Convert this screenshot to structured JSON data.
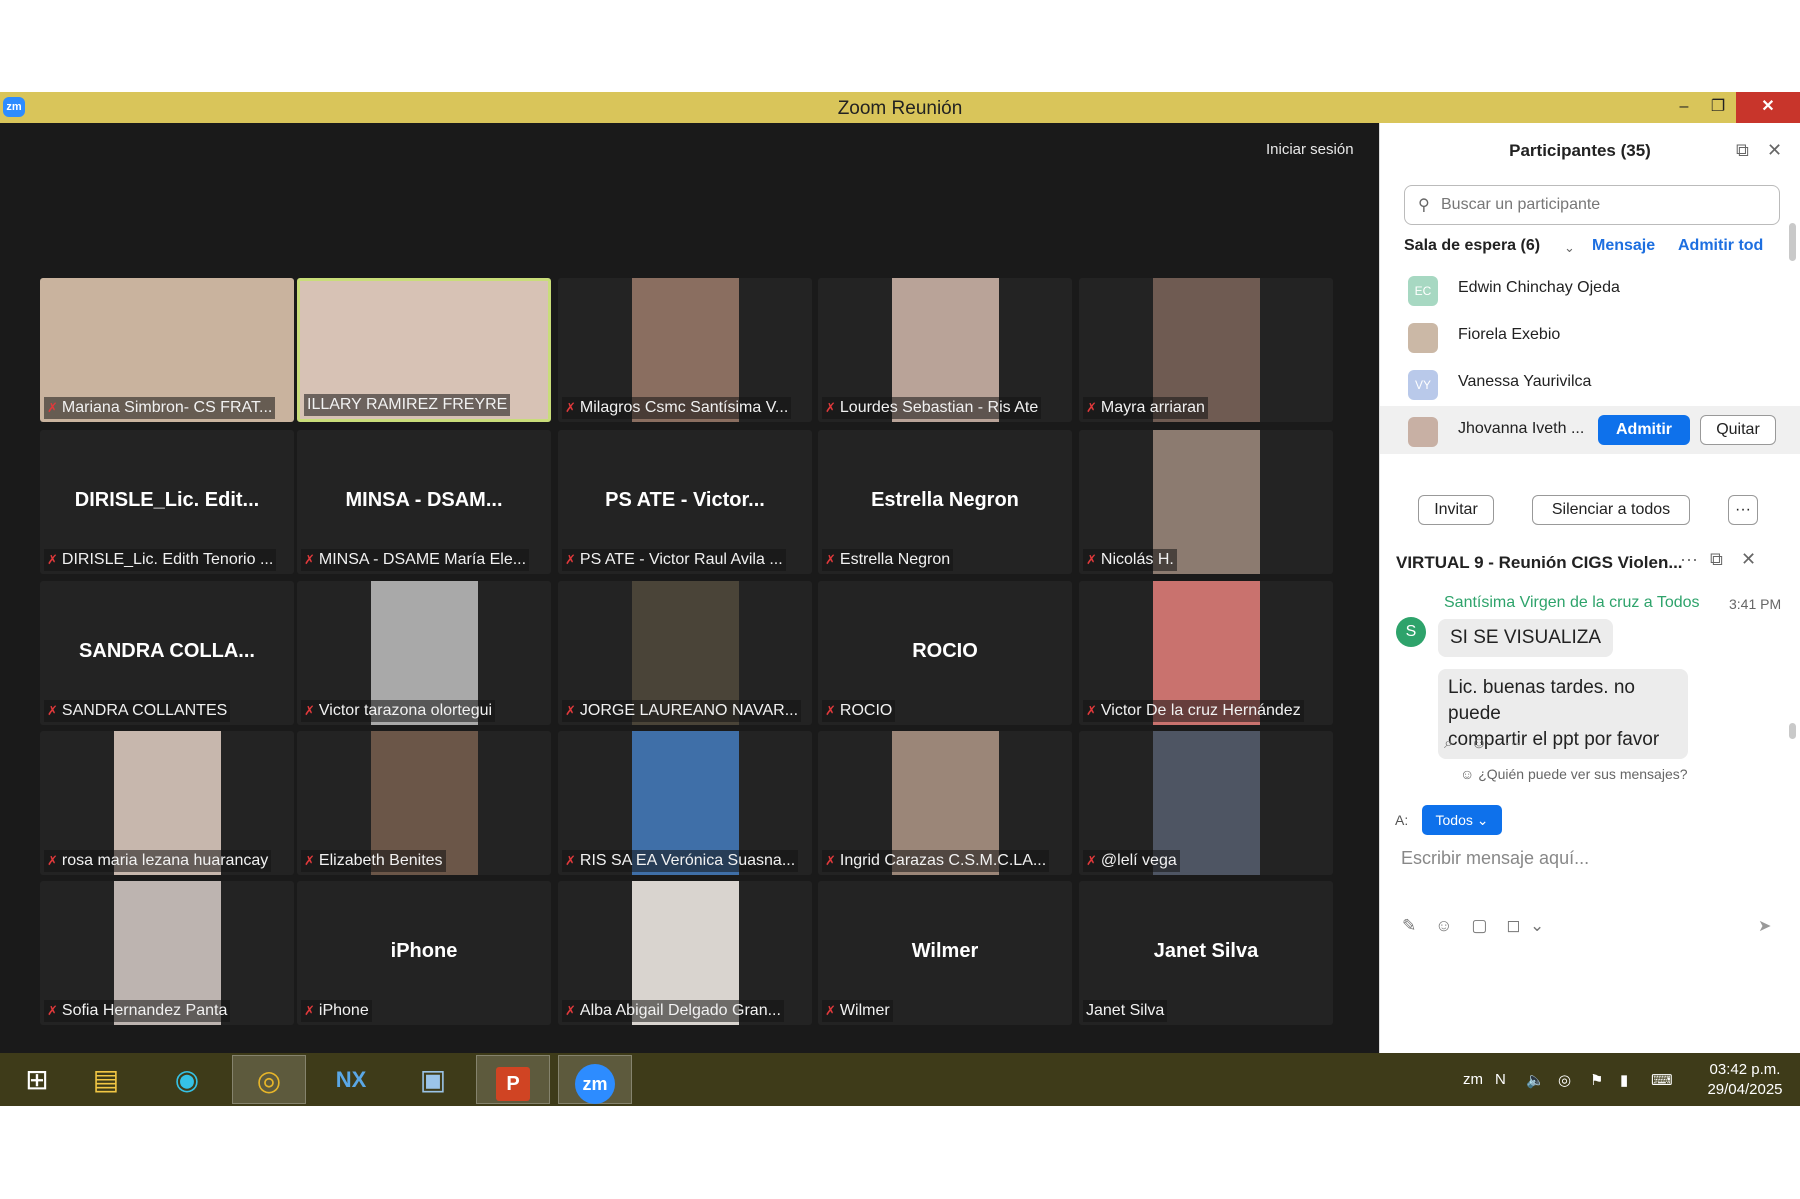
{
  "window": {
    "title": "Zoom Reunión",
    "min_icon": "–",
    "max_icon": "❐",
    "close_icon": "✕",
    "logo_text": "zm"
  },
  "video": {
    "signin": "Iniciar sesión",
    "tiles": [
      {
        "label": "Mariana Simbron- CS FRAT...",
        "center": "",
        "video": true,
        "img_color": "#c9b39e",
        "active": false,
        "muted": true
      },
      {
        "label": "ILLARY RAMIREZ FREYRE",
        "center": "",
        "video": true,
        "img_color": "#d7c2b5",
        "active": true,
        "muted": false
      },
      {
        "label": "Milagros Csmc Santísima V...",
        "center": "",
        "video": true,
        "img_color": "#8a6e60",
        "active": false,
        "muted": true
      },
      {
        "label": "Lourdes Sebastian - Ris Ate",
        "center": "",
        "video": true,
        "img_color": "#b9a398",
        "active": false,
        "muted": true
      },
      {
        "label": "Mayra arriaran",
        "center": "",
        "video": true,
        "img_color": "#6f5b52",
        "active": false,
        "muted": true
      },
      {
        "label": "DIRISLE_Lic. Edith Tenorio ...",
        "center": "DIRISLE_Lic.  Edit...",
        "video": false,
        "active": false,
        "muted": true
      },
      {
        "label": "MINSA - DSAME María Ele...",
        "center": "MINSA  -  DSAM...",
        "video": false,
        "active": false,
        "muted": true
      },
      {
        "label": "PS ATE - Victor Raul Avila ...",
        "center": "PS ATE  -  Victor...",
        "video": false,
        "active": false,
        "muted": true
      },
      {
        "label": "Estrella Negron",
        "center": "Estrella Negron",
        "video": false,
        "active": false,
        "muted": true
      },
      {
        "label": "Nicolás H.",
        "center": "",
        "video": true,
        "img_color": "#8c7b70",
        "active": false,
        "muted": true
      },
      {
        "label": "SANDRA COLLANTES",
        "center": "SANDRA  COLLA...",
        "video": false,
        "active": false,
        "muted": true
      },
      {
        "label": "Victor tarazona olortegui",
        "center": "",
        "video": true,
        "img_color": "#a9a9a9",
        "active": false,
        "muted": true
      },
      {
        "label": "JORGE LAUREANO NAVAR...",
        "center": "",
        "video": true,
        "img_color": "#4a4438",
        "active": false,
        "muted": true
      },
      {
        "label": "ROCIO",
        "center": "ROCIO",
        "video": false,
        "active": false,
        "muted": true
      },
      {
        "label": "Victor De la cruz Hernández",
        "center": "",
        "video": true,
        "img_color": "#c9726e",
        "active": false,
        "muted": true
      },
      {
        "label": "rosa maria lezana huarancay",
        "center": "",
        "video": true,
        "img_color": "#c7b7ad",
        "active": false,
        "muted": true
      },
      {
        "label": "Elizabeth Benites",
        "center": "",
        "video": true,
        "img_color": "#6b5648",
        "active": false,
        "muted": true
      },
      {
        "label": "RIS SA EA Verónica Suasna...",
        "center": "",
        "video": true,
        "img_color": "#3f6fa8",
        "active": false,
        "muted": true
      },
      {
        "label": "Ingrid  Carazas C.S.M.C.LA...",
        "center": "",
        "video": true,
        "img_color": "#9b8678",
        "active": false,
        "muted": true
      },
      {
        "label": "@lelí vega",
        "center": "",
        "video": true,
        "img_color": "#4e5563",
        "active": false,
        "muted": true
      },
      {
        "label": "Sofia Hernandez Panta",
        "center": "",
        "video": true,
        "img_color": "#bdb4b0",
        "active": false,
        "muted": true
      },
      {
        "label": "iPhone",
        "center": "iPhone",
        "video": false,
        "active": false,
        "muted": true
      },
      {
        "label": "Alba Abigail Delgado Gran...",
        "center": "",
        "video": true,
        "img_color": "#d9d4cf",
        "active": false,
        "muted": true
      },
      {
        "label": "Wilmer",
        "center": "Wilmer",
        "video": false,
        "active": false,
        "muted": true
      },
      {
        "label": "Janet Silva",
        "center": "Janet Silva",
        "video": false,
        "active": false,
        "muted": false
      }
    ]
  },
  "participants": {
    "title": "Participantes (35)",
    "search_placeholder": "Buscar un participante",
    "waiting_title": "Sala de espera (6)",
    "message_link": "Mensaje",
    "admit_all_link": "Admitir tod",
    "waiting_list": [
      {
        "name": "Edwin Chinchay Ojeda",
        "initials": "EC",
        "color": "#a7d8c2"
      },
      {
        "name": "Fiorela Exebio",
        "initials": "",
        "color": "#cbb8a6"
      },
      {
        "name": "Vanessa Yaurivilca",
        "initials": "VY",
        "color": "#b9c9ea"
      },
      {
        "name": "Jhovanna Iveth ...",
        "initials": "",
        "color": "#c8b0a4"
      }
    ],
    "admit_label": "Admitir",
    "remove_label": "Quitar",
    "invite_label": "Invitar",
    "mute_all_label": "Silenciar a todos",
    "more_label": "···"
  },
  "chat": {
    "title": "VIRTUAL 9 - Reunión CIGS Violen...",
    "more_icon": "···",
    "sender": "Santísima Virgen de la cruz a Todos",
    "time": "3:41 PM",
    "avatar_letter": "S",
    "messages": [
      "SI SE VISUALIZA",
      "Lic. buenas tardes. no puede",
      "compartir el ppt por favor"
    ],
    "who_can_see": "¿Quién puede ver sus mensajes?",
    "to_label": "A:",
    "to_value": "Todos ⌄",
    "compose_placeholder": "Escribir mensaje aquí..."
  },
  "taskbar": {
    "clock_time": "03:42 p.m.",
    "clock_date": "29/04/2025",
    "zoom_label": "zm",
    "ppt_label": "P"
  },
  "colors": {
    "titlebar": "#d9c55a",
    "zoom_blue": "#0e71eb",
    "chat_green": "#2ea36b",
    "mic_red": "#e0393b"
  }
}
